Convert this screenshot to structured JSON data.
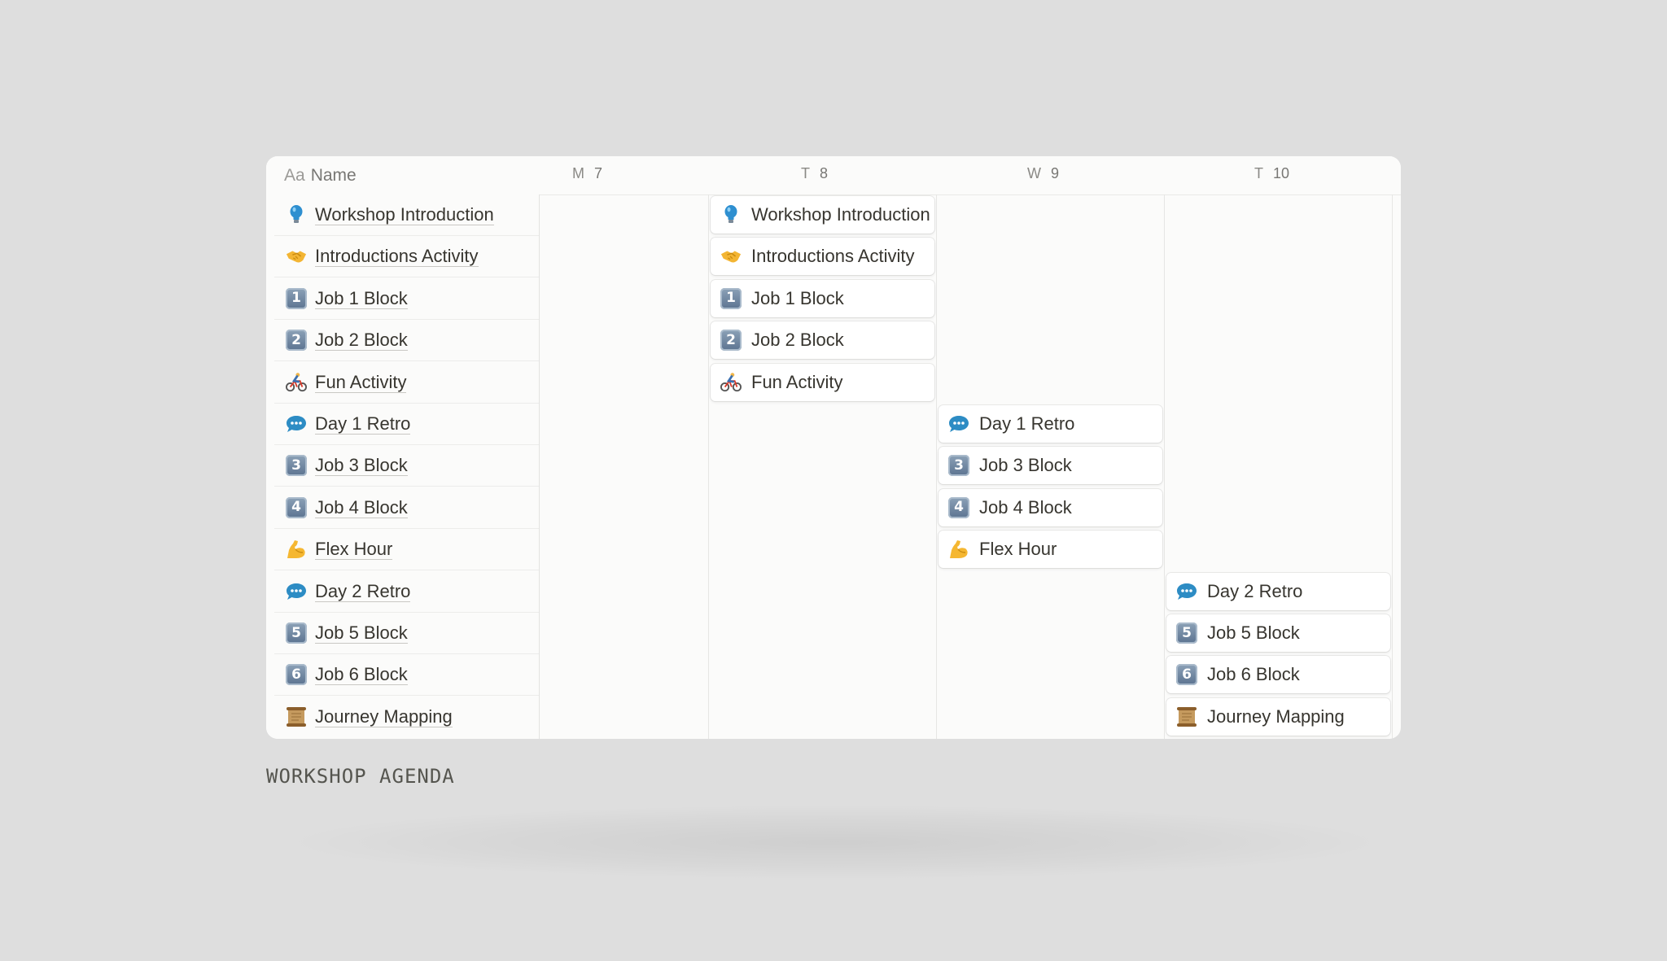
{
  "header": {
    "name_prefix": "Aa",
    "name_label": "Name",
    "days": [
      {
        "letter": "M",
        "num": "7"
      },
      {
        "letter": "T",
        "num": "8"
      },
      {
        "letter": "W",
        "num": "9"
      },
      {
        "letter": "T",
        "num": "10"
      }
    ]
  },
  "items": [
    {
      "label": "Workshop Introduction",
      "icon": "lightbulb-icon"
    },
    {
      "label": "Introductions Activity",
      "icon": "handshake-icon"
    },
    {
      "label": "Job 1 Block",
      "icon": "keycap-1-icon",
      "key": "1"
    },
    {
      "label": "Job 2 Block",
      "icon": "keycap-2-icon",
      "key": "2"
    },
    {
      "label": "Fun Activity",
      "icon": "cyclist-icon"
    },
    {
      "label": "Day 1 Retro",
      "icon": "speech-bubble-icon"
    },
    {
      "label": "Job 3 Block",
      "icon": "keycap-3-icon",
      "key": "3"
    },
    {
      "label": "Job 4 Block",
      "icon": "keycap-4-icon",
      "key": "4"
    },
    {
      "label": "Flex Hour",
      "icon": "flexed-biceps-icon"
    },
    {
      "label": "Day 2 Retro",
      "icon": "speech-bubble-icon"
    },
    {
      "label": "Job 5 Block",
      "icon": "keycap-5-icon",
      "key": "5"
    },
    {
      "label": "Job 6 Block",
      "icon": "keycap-6-icon",
      "key": "6"
    },
    {
      "label": "Journey Mapping",
      "icon": "scroll-icon"
    }
  ],
  "events": {
    "day2": [
      0,
      1,
      2,
      3,
      4
    ],
    "day3": [
      5,
      6,
      7,
      8
    ],
    "day4": [
      9,
      10,
      11,
      12
    ]
  },
  "caption": "WORKSHOP AGENDA"
}
